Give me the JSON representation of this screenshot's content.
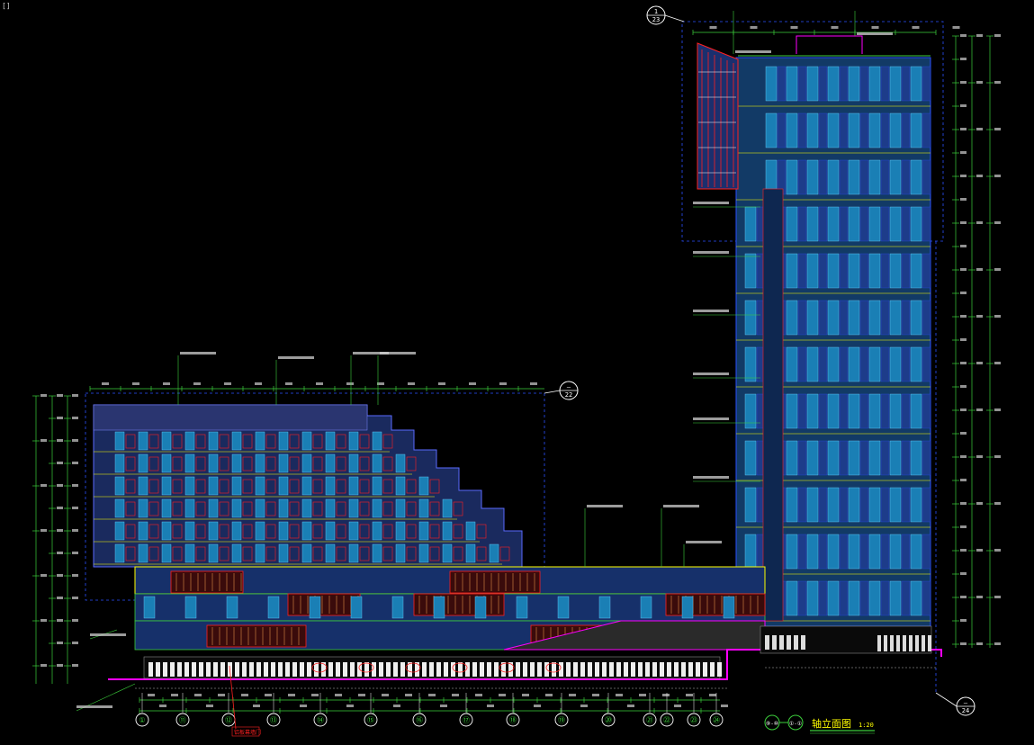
{
  "corner_mark": "[]",
  "section_markers": {
    "top_right": {
      "num": "1",
      "sheet": "23"
    },
    "mid_left": {
      "num": "—",
      "sheet": "22"
    },
    "bottom_right": {
      "num": "—",
      "sheet": "24"
    }
  },
  "elevation_title": {
    "from_axis": "⑨-⑩",
    "to_axis": "①-①",
    "text": "轴立面图",
    "scale": "1:20"
  },
  "callout_red": "铝板幕墙门",
  "axis_bubbles": [
    "①",
    "⑪",
    "⑫",
    "⑬",
    "⑭",
    "⑮",
    "⑯",
    "⑰",
    "⑱",
    "⑲",
    "⑳",
    "㉑",
    "㉒",
    "㉓",
    "㉔"
  ],
  "colors": {
    "background": "#000000",
    "facade_blue": "#1a7fb5",
    "grid_blue": "#2b4fff",
    "dim_green": "#3ccf3c",
    "accent_magenta": "#ff00ff",
    "accent_red": "#ff2020",
    "accent_yellow": "#ffff00",
    "dim_text": "#d0d0d0"
  }
}
